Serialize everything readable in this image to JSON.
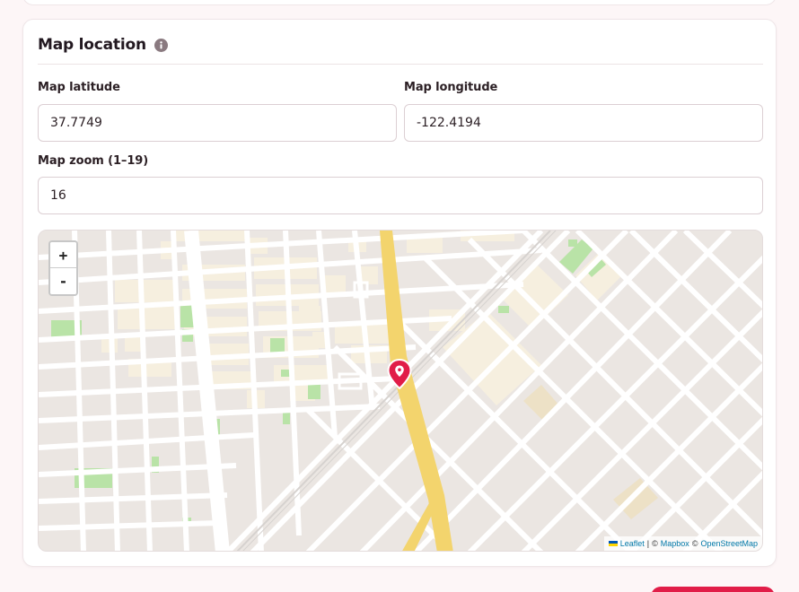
{
  "card": {
    "title": "Map location",
    "info_icon": "info-icon"
  },
  "fields": {
    "latitude": {
      "label": "Map latitude",
      "value": "37.7749"
    },
    "longitude": {
      "label": "Map longitude",
      "value": "-122.4194"
    },
    "zoom": {
      "label": "Map zoom (1–19)",
      "value": "16"
    }
  },
  "map": {
    "zoom_in_label": "+",
    "zoom_out_label": "-",
    "marker_icon": "map-pin-icon",
    "attribution": {
      "leaflet": "Leaflet",
      "sep": "|",
      "copy1": "©",
      "mapbox": "Mapbox",
      "copy2": "©",
      "osm": "OpenStreetMap"
    }
  },
  "colors": {
    "accent": "#e11d48",
    "highway": "#f3d46d",
    "block": "#f6efdf",
    "park": "#b9e3a7",
    "road": "#ffffff",
    "ground": "#ebe6e2"
  }
}
